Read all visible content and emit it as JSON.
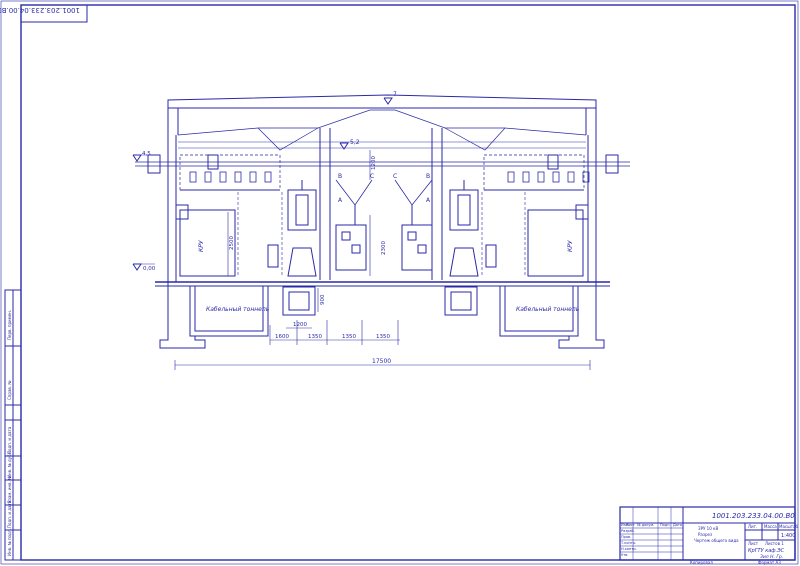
{
  "drawing_code": "1001.203.233.04.00.В0",
  "drawing_code_rotated": "1001.203.233.04.00.В0",
  "dims": {
    "elev_top": "7",
    "elev_mid": "5,2",
    "elev_left": "4,5",
    "elev_zero": "0,00",
    "h1200": "1200",
    "h2500": "2500",
    "h2300": "2300",
    "h900": "900",
    "w1200": "1200",
    "w1600": "1600",
    "w1350a": "1350",
    "w1350b": "1350",
    "w1350c": "1350",
    "total": "17500"
  },
  "labels": {
    "kru_left": "КРУ",
    "kru_right": "КРУ",
    "tunnel_left": "Кабельный тоннель",
    "tunnel_right": "Кабельный тоннель",
    "phase_b_left": "В",
    "phase_c_left": "С",
    "phase_a_left": "А",
    "phase_c_right": "С",
    "phase_b_right": "В",
    "phase_a_right": "А"
  },
  "margin_labels": [
    "Перв. примен.",
    "Справ. №",
    "Подп. и дата",
    "Инв. № дубл.",
    "Взам. инв. №",
    "Подп. и дата",
    "Инв. № подл."
  ],
  "title_block": {
    "code": "1001.203.233.04.00.В0",
    "name1": "ЗРУ 10 кВ",
    "name2": "Разрез",
    "name3": "Чертеж общего вида",
    "scale": "1:400",
    "org1": "КрГТУ каф.ЭС",
    "org2": "Зил Н. Гр.",
    "col_lit": "Лит.",
    "col_mass": "Масса",
    "col_scale": "Масштаб",
    "sheet": "Лист",
    "sheets": "Листов  1",
    "row_izm": "Изм.",
    "row_list": "Лист",
    "row_doc": "№ докум.",
    "row_sign": "Подп.",
    "row_date": "Дата",
    "role1": "Разраб.",
    "role2": "Пров.",
    "role3": "Т.контр.",
    "role4": "Н.контр.",
    "role5": "Утв.",
    "copied": "Копировал",
    "format": "Формат  А3"
  }
}
